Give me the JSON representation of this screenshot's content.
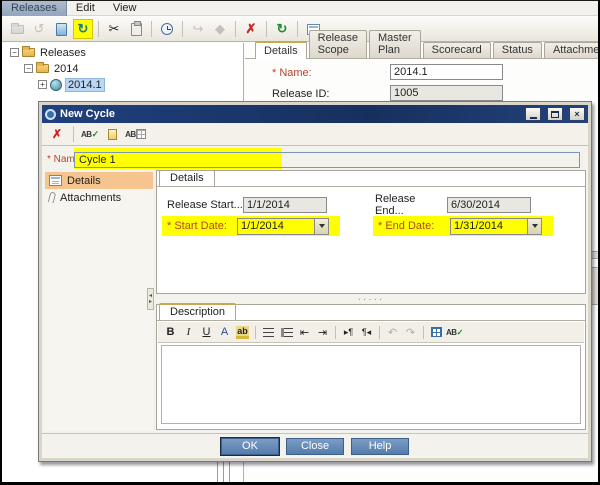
{
  "menubar": {
    "items": [
      {
        "label": "Releases"
      },
      {
        "label": "Edit"
      },
      {
        "label": "View"
      }
    ]
  },
  "toolbar": {
    "glyphs": {
      "cut": "✂",
      "delete": "✗",
      "refresh": "↻",
      "goto": "↪",
      "milestone": "◆",
      "cycle": "↻",
      "wizard": "↺"
    }
  },
  "tree": {
    "expanders": {
      "minus": "−",
      "plus": "+"
    },
    "items": [
      {
        "label": "Releases"
      },
      {
        "label": "2014"
      },
      {
        "label": "2014.1"
      }
    ]
  },
  "release_panel": {
    "tabs": [
      {
        "label": "Details"
      },
      {
        "label": "Release Scope"
      },
      {
        "label": "Master Plan"
      },
      {
        "label": "Scorecard"
      },
      {
        "label": "Status"
      },
      {
        "label": "Attachments"
      }
    ],
    "fields": {
      "name_label": "* Name:",
      "name_value": "2014.1",
      "release_id_label": "Release ID:",
      "release_id_value": "1005"
    }
  },
  "dialog": {
    "title": "New Cycle",
    "window_buttons": {
      "close_glyph": "×"
    },
    "toolbar_icons": {
      "clear": "✗",
      "spell": "AB",
      "check": "✓"
    },
    "name_label": "* Name:",
    "name_value": "Cycle 1",
    "sidebar": {
      "items": [
        {
          "label": "Details"
        },
        {
          "label": "Attachments"
        }
      ]
    },
    "details_tab_label": "Details",
    "form": {
      "release_start_label": "Release Start...",
      "release_start_value": "1/1/2014",
      "release_end_label": "Release End...",
      "release_end_value": "6/30/2014",
      "start_date_label": "* Start Date:",
      "start_date_value": "1/1/2014",
      "end_date_label": "* End Date:",
      "end_date_value": "1/31/2014"
    },
    "splitter_dots": "·····",
    "description": {
      "tab_label": "Description",
      "icons": {
        "bold": "B",
        "italic": "I",
        "underline": "U",
        "font_color": "A",
        "highlight": "ab",
        "outdent": "⇤",
        "indent": "⇥",
        "ltr": "▸¶",
        "rtl": "¶◂",
        "undo": "↶",
        "redo": "↷",
        "spell": "AB",
        "check": "✓"
      }
    },
    "buttons": {
      "ok": "OK",
      "close": "Close",
      "help": "Help"
    }
  },
  "colors": {
    "highlight_yellow": "#ffff00",
    "required_red": "#b5442a",
    "titlebar_navy": "#1d3c78",
    "selected_peach": "#f6c48e",
    "button_blue": "#557cab",
    "tree_selection": "#b9d6f2"
  }
}
